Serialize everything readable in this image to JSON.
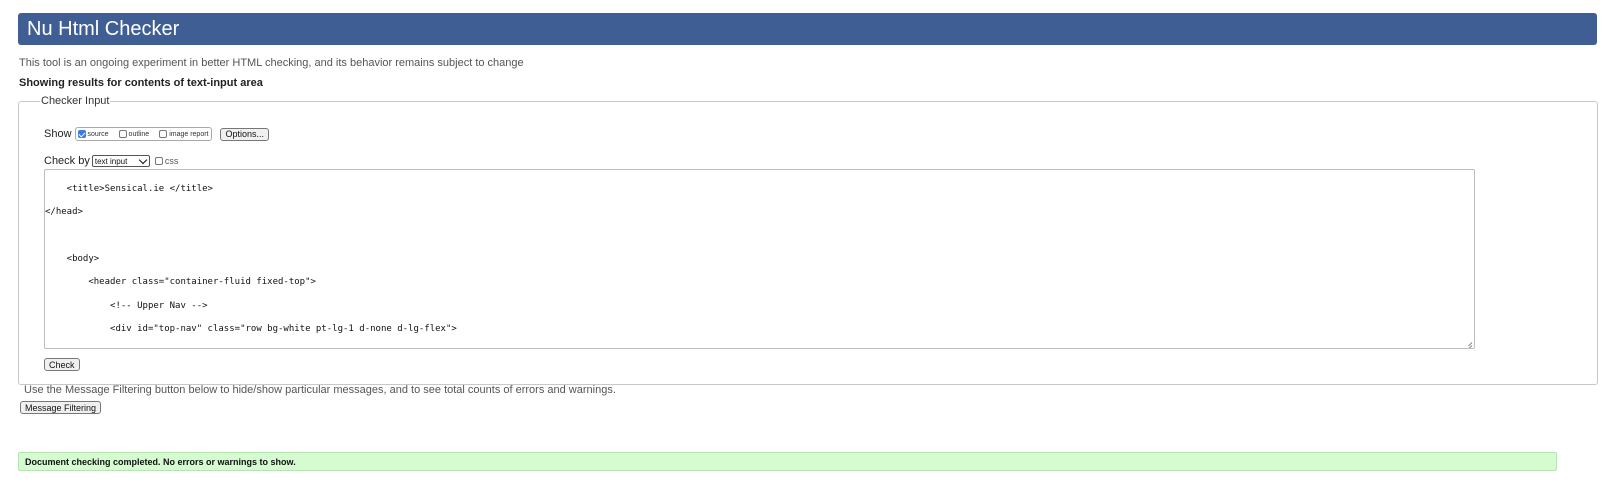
{
  "header": {
    "title": "Nu Html Checker"
  },
  "intro_text": "This tool is an ongoing experiment in better HTML checking, and its behavior remains subject to change",
  "showing_text": "Showing results for contents of text-input area",
  "checker_input": {
    "legend": "Checker Input",
    "show_label": "Show",
    "show_options": [
      {
        "label": "source",
        "checked": true
      },
      {
        "label": "outline",
        "checked": false
      },
      {
        "label": "image report",
        "checked": false
      }
    ],
    "options_button": "Options...",
    "check_by_label": "Check by",
    "check_by_value": "text input",
    "css_label": "css",
    "css_checked": false,
    "source_lines": [
      "    <title>Sensical.ie </title>",
      "</head>",
      "",
      "",
      "    <body>",
      "        <header class=\"container-fluid fixed-top\">",
      "            <!-- Upper Nav -->",
      "            <div id=\"top-nav\" class=\"row bg-white pt-lg-1 d-none d-lg-flex\">"
    ],
    "check_button": "Check"
  },
  "filter_note": "Use the Message Filtering button below to hide/show particular messages, and to see total counts of errors and warnings.",
  "filter_button": "Message Filtering",
  "result_message": "Document checking completed. No errors or warnings to show."
}
